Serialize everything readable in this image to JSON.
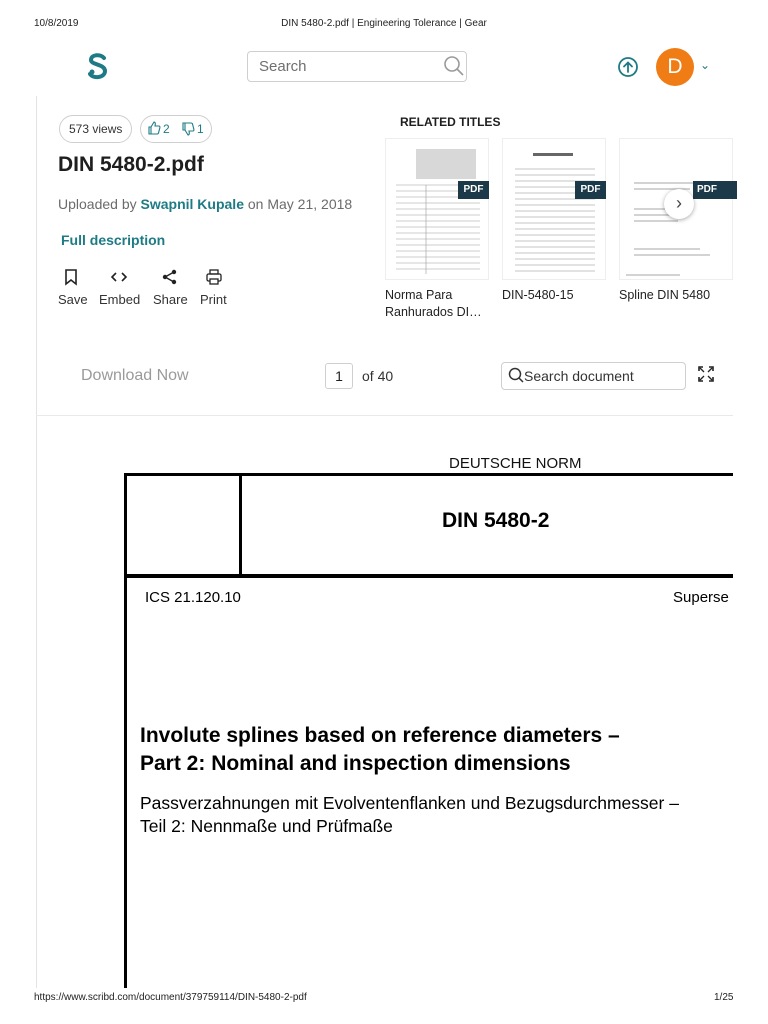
{
  "print_header": {
    "date": "10/8/2019",
    "title": "DIN 5480-2.pdf | Engineering Tolerance | Gear"
  },
  "header": {
    "search_placeholder": "Search",
    "avatar_initial": "D"
  },
  "doc": {
    "views": "573 views",
    "likes": "2",
    "dislikes": "1",
    "title": "DIN 5480-2.pdf",
    "uploaded_prefix": "Uploaded by",
    "uploader": "Swapnil Kupale",
    "uploaded_suffix": "on May 21, 2018",
    "full_description": "Full description",
    "actions": [
      {
        "label": "Save",
        "icon": "bookmark-icon"
      },
      {
        "label": "Embed",
        "icon": "code-icon"
      },
      {
        "label": "Share",
        "icon": "share-icon"
      },
      {
        "label": "Print",
        "icon": "printer-icon"
      }
    ]
  },
  "related": {
    "heading": "RELATED TITLES",
    "badge": "PDF",
    "items": [
      {
        "line1": "Norma Para",
        "line2": "Ranhurados DI…"
      },
      {
        "line1": "DIN-5480-15",
        "line2": ""
      },
      {
        "line1": "Spline DIN 5480",
        "line2": ""
      }
    ]
  },
  "toolbar": {
    "download": "Download Now",
    "page": "1",
    "of_pages": "of 40",
    "search_doc": "Search document"
  },
  "page_content": {
    "deutsche_norm": "DEUTSCHE NORM",
    "din_number": "DIN 5480-2",
    "ics": "ICS 21.120.10",
    "supersedes": "Superse",
    "title_en_line1": "Involute splines based on reference diameters –",
    "title_en_line2": "Part 2: Nominal and inspection dimensions",
    "title_de_line1": "Passverzahnungen mit Evolventenflanken und Bezugsdurchmesser –",
    "title_de_line2": "Teil 2: Nennmaße und Prüfmaße"
  },
  "print_footer": {
    "url": "https://www.scribd.com/document/379759114/DIN-5480-2-pdf",
    "page": "1/25"
  },
  "colors": {
    "teal": "#1e7b85",
    "avatar": "#f07c16",
    "badge": "#1b3948"
  }
}
